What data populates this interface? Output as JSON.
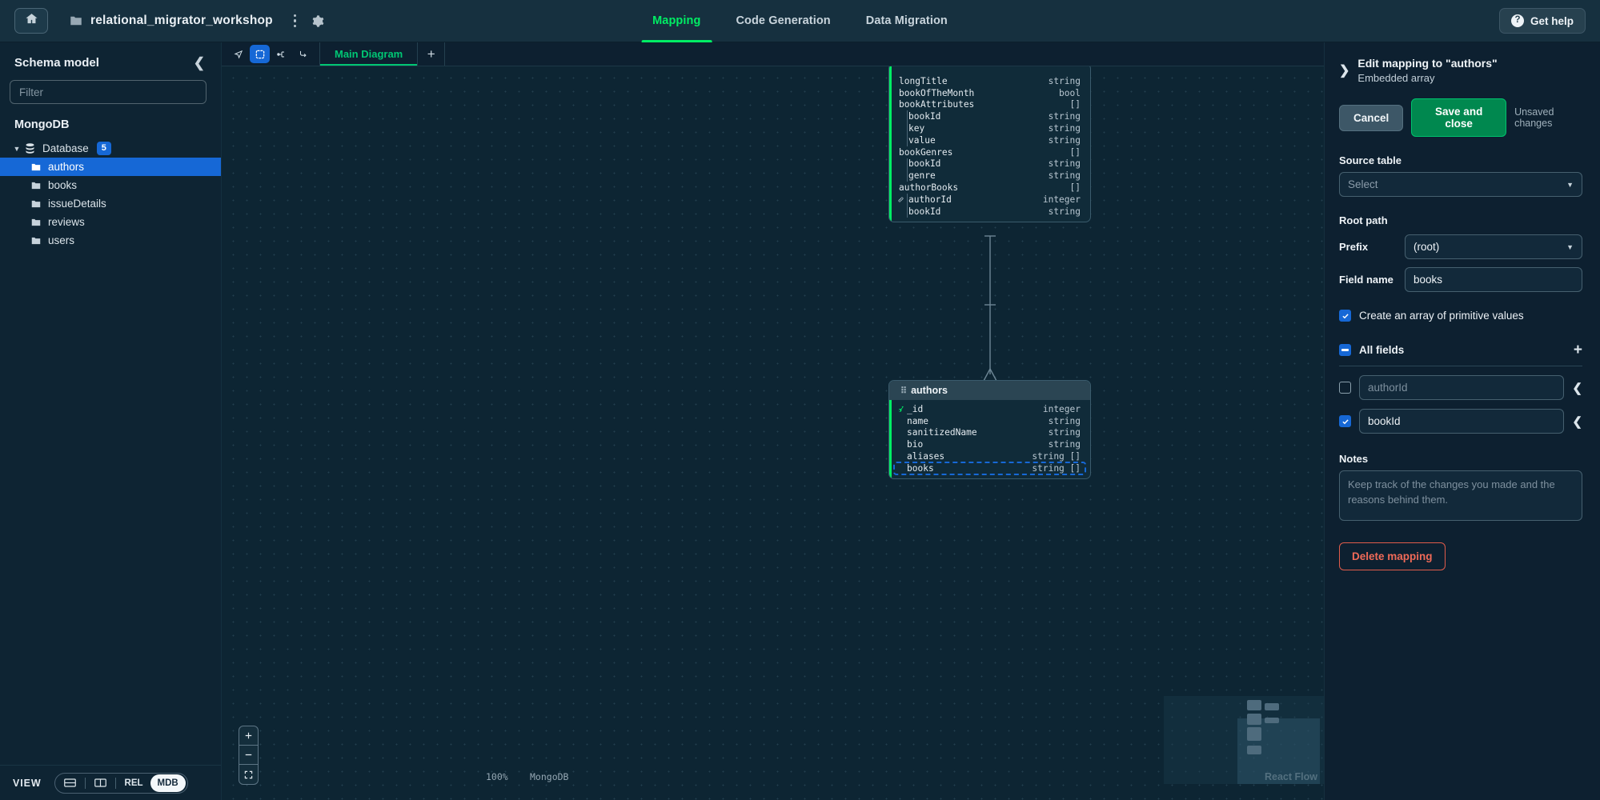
{
  "topbar": {
    "home_icon": "home-icon",
    "folder_icon": "folder-icon",
    "project_name": "relational_migrator_workshop",
    "kebab_icon": "more-vertical-icon",
    "gear_icon": "gear-icon",
    "tabs": [
      {
        "label": "Mapping",
        "active": true
      },
      {
        "label": "Code Generation",
        "active": false
      },
      {
        "label": "Data Migration",
        "active": false
      }
    ],
    "help_label": "Get help",
    "help_icon": "question-circle-icon"
  },
  "sidebar": {
    "title": "Schema model",
    "collapse_icon": "chevron-left-icon",
    "filter_placeholder": "Filter",
    "group_label": "MongoDB",
    "database_label": "Database",
    "database_count": "5",
    "collections": [
      {
        "label": "authors",
        "selected": true
      },
      {
        "label": "books",
        "selected": false
      },
      {
        "label": "issueDetails",
        "selected": false
      },
      {
        "label": "reviews",
        "selected": false
      },
      {
        "label": "users",
        "selected": false
      }
    ],
    "view_label": "VIEW",
    "view_options": [
      {
        "label": "",
        "icon": "split-horizontal-icon",
        "active": false
      },
      {
        "label": "",
        "icon": "split-vertical-icon",
        "active": false
      },
      {
        "label": "REL",
        "icon": "",
        "active": false
      },
      {
        "label": "MDB",
        "icon": "",
        "active": true
      }
    ]
  },
  "diagram_toolbar": {
    "tools": [
      {
        "name": "select-cursor-tool",
        "active": false
      },
      {
        "name": "marquee-select-tool",
        "active": true
      },
      {
        "name": "add-relationship-tool",
        "active": false
      },
      {
        "name": "edge-routing-tool",
        "active": false
      }
    ],
    "tab_label": "Main Diagram",
    "add_tab_label": "+"
  },
  "canvas": {
    "zoom_level": "100%",
    "database_type": "MongoDB",
    "attribution": "React Flow",
    "zoom_in_icon": "plus-icon",
    "zoom_out_icon": "minus-icon",
    "fit_view_icon": "fit-screen-icon",
    "nodes": [
      {
        "name": "books",
        "title_visible": false,
        "fields": [
          {
            "name": "longTitle",
            "type": "string",
            "indent": 0,
            "icon": ""
          },
          {
            "name": "bookOfTheMonth",
            "type": "bool",
            "indent": 0,
            "icon": ""
          },
          {
            "name": "bookAttributes",
            "type": "[]",
            "indent": 0,
            "icon": ""
          },
          {
            "name": "bookId",
            "type": "string",
            "indent": 1,
            "icon": ""
          },
          {
            "name": "key",
            "type": "string",
            "indent": 1,
            "icon": ""
          },
          {
            "name": "value",
            "type": "string",
            "indent": 1,
            "icon": ""
          },
          {
            "name": "bookGenres",
            "type": "[]",
            "indent": 0,
            "icon": ""
          },
          {
            "name": "bookId",
            "type": "string",
            "indent": 1,
            "icon": ""
          },
          {
            "name": "genre",
            "type": "string",
            "indent": 1,
            "icon": ""
          },
          {
            "name": "authorBooks",
            "type": "[]",
            "indent": 0,
            "icon": ""
          },
          {
            "name": "authorId",
            "type": "integer",
            "indent": 1,
            "icon": "link-icon"
          },
          {
            "name": "bookId",
            "type": "string",
            "indent": 1,
            "icon": ""
          }
        ]
      },
      {
        "name": "authors",
        "title_visible": true,
        "fields": [
          {
            "name": "_id",
            "type": "integer",
            "indent": 0,
            "icon": "key-icon",
            "selected": false
          },
          {
            "name": "name",
            "type": "string",
            "indent": 0,
            "icon": "",
            "selected": false
          },
          {
            "name": "sanitizedName",
            "type": "string",
            "indent": 0,
            "icon": "",
            "selected": false
          },
          {
            "name": "bio",
            "type": "string",
            "indent": 0,
            "icon": "",
            "selected": false
          },
          {
            "name": "aliases",
            "type": "string []",
            "indent": 0,
            "icon": "",
            "selected": false
          },
          {
            "name": "books",
            "type": "string []",
            "indent": 0,
            "icon": "",
            "selected": true
          }
        ]
      }
    ]
  },
  "right_panel": {
    "collapse_icon": "chevron-right-icon",
    "title": "Edit mapping to \"authors\"",
    "subtitle": "Embedded array",
    "cancel_label": "Cancel",
    "save_label": "Save and close",
    "unsaved_label": "Unsaved changes",
    "source_table_label": "Source table",
    "source_table_value": "Select",
    "root_path_label": "Root path",
    "prefix_label": "Prefix",
    "prefix_value": "(root)",
    "field_name_label": "Field name",
    "field_name_value": "books",
    "primitive_checkbox_label": "Create an array of primitive values",
    "primitive_checkbox_checked": true,
    "all_fields_label": "All fields",
    "all_fields_state": "indeterminate",
    "add_field_icon": "plus-icon",
    "fields": [
      {
        "value": "",
        "placeholder": "authorId",
        "checked": false,
        "chevron_icon": "chevron-left-icon"
      },
      {
        "value": "bookId",
        "placeholder": "",
        "checked": true,
        "chevron_icon": "chevron-left-icon"
      }
    ],
    "notes_label": "Notes",
    "notes_placeholder": "Keep track of the changes you made and the reasons behind them.",
    "delete_label": "Delete mapping"
  },
  "colors": {
    "accent_green": "#00ed64",
    "accent_blue": "#1668d6",
    "danger_red": "#f06a58",
    "bg": "#0d2030"
  }
}
